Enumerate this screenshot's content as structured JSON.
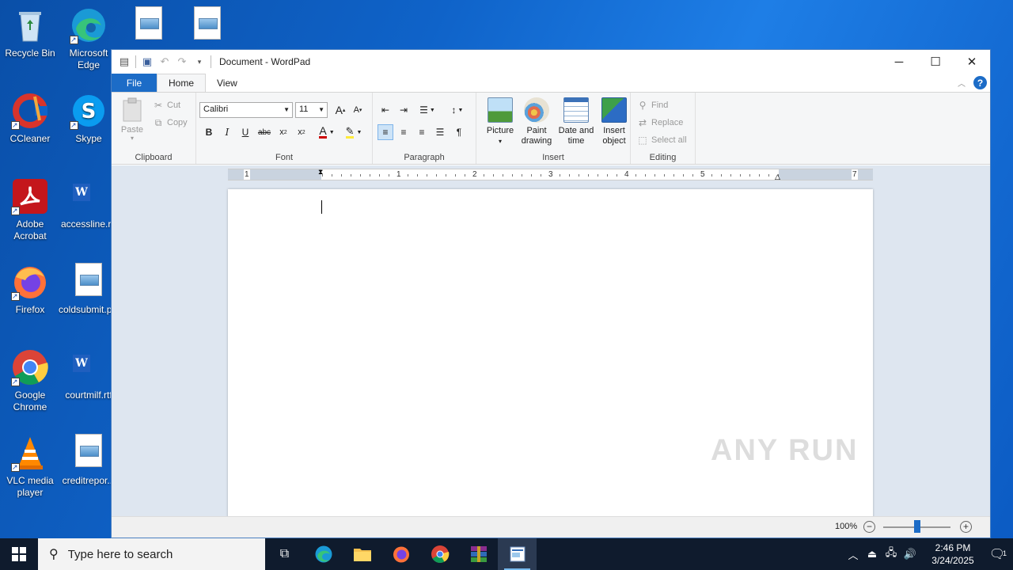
{
  "desktop": {
    "icons": [
      {
        "label": "Recycle Bin"
      },
      {
        "label": "Microsoft Edge"
      },
      {
        "label": "CCleaner"
      },
      {
        "label": "Skype"
      },
      {
        "label": "Adobe Acrobat"
      },
      {
        "label": "accessline.rtf"
      },
      {
        "label": "Firefox"
      },
      {
        "label": "coldsubmit.png"
      },
      {
        "label": "Google Chrome"
      },
      {
        "label": "courtmilf.rtf"
      },
      {
        "label": "VLC media player"
      },
      {
        "label": "creditrepor..."
      }
    ]
  },
  "window": {
    "title": "Document - WordPad",
    "tabs": {
      "file": "File",
      "home": "Home",
      "view": "View"
    },
    "help_label": "?",
    "clipboard": {
      "paste": "Paste",
      "cut": "Cut",
      "copy": "Copy",
      "group": "Clipboard"
    },
    "font": {
      "family": "Calibri",
      "size": "11",
      "group": "Font"
    },
    "paragraph": {
      "group": "Paragraph"
    },
    "insert": {
      "picture": "Picture",
      "paint_drawing": "Paint drawing",
      "date_time": "Date and time",
      "insert_object": "Insert object",
      "group": "Insert"
    },
    "editing": {
      "find": "Find",
      "replace": "Replace",
      "select_all": "Select all",
      "group": "Editing"
    },
    "ruler_numbers": [
      "1",
      "1",
      "2",
      "3",
      "4",
      "5",
      "7"
    ],
    "zoom": "100%"
  },
  "watermark": "ANY RUN",
  "taskbar": {
    "search_placeholder": "Type here to search",
    "time": "2:46 PM",
    "date": "3/24/2025",
    "notification_count": "1"
  }
}
